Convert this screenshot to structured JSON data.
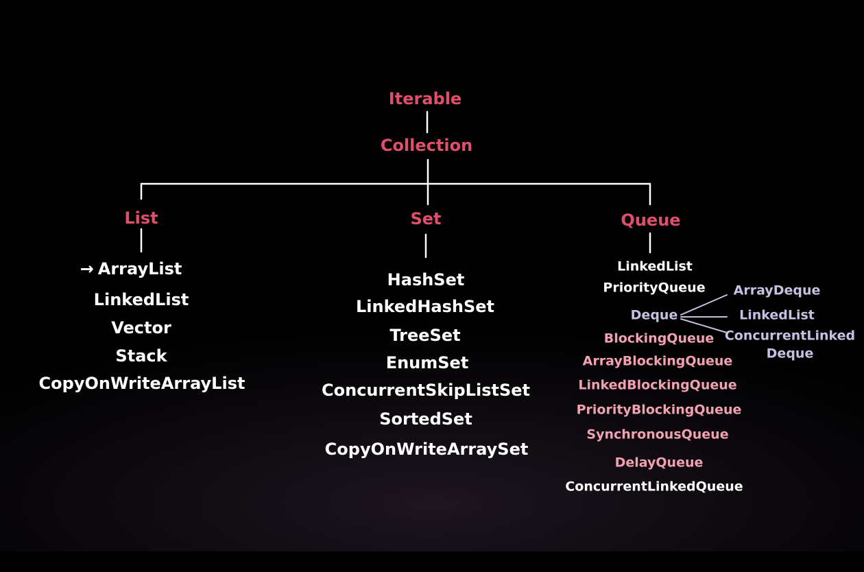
{
  "root": {
    "iterable": "Iterable",
    "collection": "Collection"
  },
  "list": {
    "title": "List",
    "arrow": "→",
    "items": [
      "ArrayList",
      "LinkedList",
      "Vector",
      "Stack",
      "CopyOnWriteArrayList"
    ]
  },
  "set": {
    "title": "Set",
    "items": [
      "HashSet",
      "LinkedHashSet",
      "TreeSet",
      "EnumSet",
      "ConcurrentSkipListSet",
      "SortedSet",
      "CopyOnWriteArraySet"
    ]
  },
  "queue": {
    "title": "Queue",
    "items": [
      "LinkedList",
      "PriorityQueue"
    ],
    "deque": {
      "label": "Deque",
      "children": [
        "ArrayDeque",
        "LinkedList",
        "ConcurrentLinked",
        "Deque"
      ]
    },
    "blocking": {
      "label": "BlockingQueue",
      "items": [
        "ArrayBlockingQueue",
        "LinkedBlockingQueue",
        "PriorityBlockingQueue",
        "SynchronousQueue",
        "DelayQueue"
      ]
    },
    "last": "ConcurrentLinkedQueue"
  },
  "colors": {
    "interface": "#e04f6a",
    "implementation": "#ffffff",
    "deque": "#c6c0e2",
    "blocking": "#f2a1b3",
    "line": "#ffffff"
  }
}
